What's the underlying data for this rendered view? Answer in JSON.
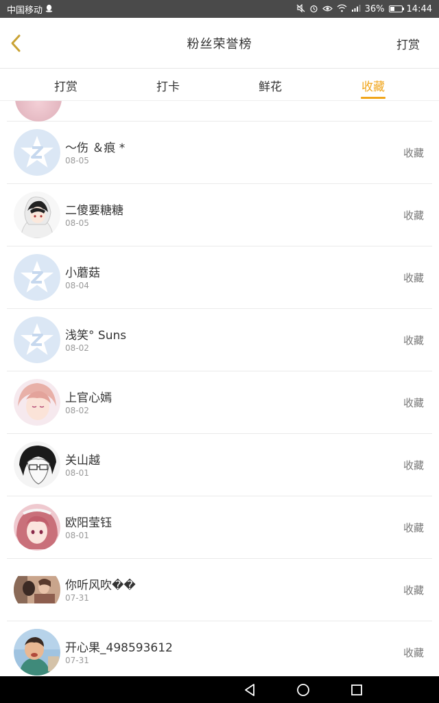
{
  "status_bar": {
    "carrier": "中国移动",
    "battery_percent": "36%",
    "battery_level": 0.36,
    "time": "14:44",
    "icons": [
      "qq-icon",
      "mute-icon",
      "alarm-icon",
      "eye-icon",
      "wifi-icon",
      "signal-icon",
      "battery-icon"
    ]
  },
  "header": {
    "title": "粉丝荣誉榜",
    "action_label": "打赏",
    "back_icon": "chevron-left-icon",
    "accent_color": "#f0a51b"
  },
  "tabs": [
    {
      "label": "打赏",
      "active": false
    },
    {
      "label": "打卡",
      "active": false
    },
    {
      "label": "鲜花",
      "active": false
    },
    {
      "label": "收藏",
      "active": true
    }
  ],
  "list": {
    "items": [
      {
        "name": "～伤 ＆痕 *",
        "date": "08-05",
        "action": "收藏",
        "avatar": "default-qq-avatar"
      },
      {
        "name": "二傻要糖糖",
        "date": "08-05",
        "action": "收藏",
        "avatar": "anime-boy-white-hood-avatar"
      },
      {
        "name": "小蘑菇",
        "date": "08-04",
        "action": "收藏",
        "avatar": "default-qq-avatar"
      },
      {
        "name": "浅笑° Suns",
        "date": "08-02",
        "action": "收藏",
        "avatar": "default-qq-avatar"
      },
      {
        "name": "上官心嫣",
        "date": "08-02",
        "action": "收藏",
        "avatar": "anime-pink-hair-avatar"
      },
      {
        "name": "关山越",
        "date": "08-01",
        "action": "收藏",
        "avatar": "manga-glasses-avatar"
      },
      {
        "name": "欧阳莹钰",
        "date": "08-01",
        "action": "收藏",
        "avatar": "anime-red-hair-avatar"
      },
      {
        "name": "你听风吹��",
        "date": "07-31",
        "action": "收藏",
        "avatar": "photo-couple-avatar"
      },
      {
        "name": "开心果_498593612",
        "date": "07-31",
        "action": "收藏",
        "avatar": "photo-child-avatar"
      }
    ]
  },
  "nav_bar": {
    "buttons": [
      "back-triangle-icon",
      "home-circle-icon",
      "recents-square-icon"
    ]
  }
}
